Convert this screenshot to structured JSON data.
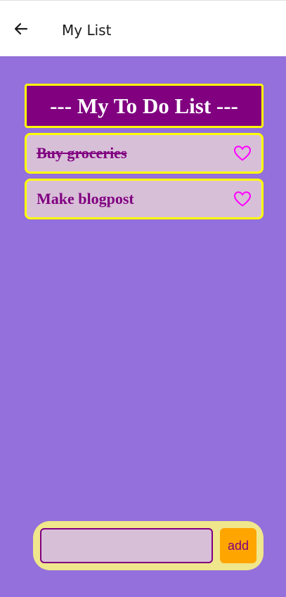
{
  "app_bar": {
    "title": "My List",
    "back_icon": "arrow-left-icon"
  },
  "list": {
    "header": "--- My To Do List ---",
    "items": [
      {
        "text": "Buy groceries",
        "completed": true,
        "icon": "heart-outline-icon"
      },
      {
        "text": "Make blogpost",
        "completed": false,
        "icon": "heart-outline-icon"
      }
    ]
  },
  "input_bar": {
    "input_value": "",
    "input_placeholder": "",
    "add_label": "add"
  },
  "colors": {
    "page_background": "#9370db",
    "header_background": "#800080",
    "item_background": "#d8bfd8",
    "item_border": "#ffff00",
    "heart": "#ff00ff",
    "input_bar_background": "#f0e68c",
    "add_button": "#ffa500"
  }
}
